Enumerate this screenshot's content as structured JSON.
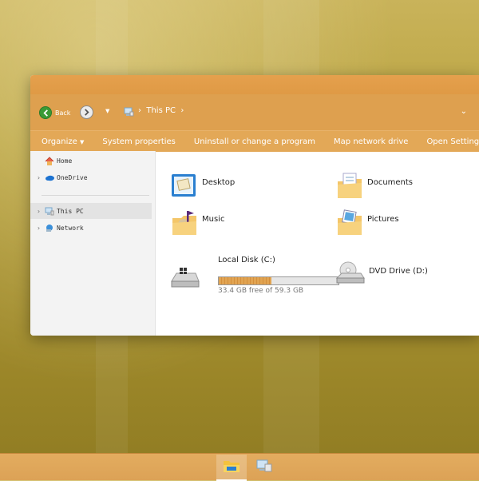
{
  "window": {
    "nav": {
      "back_label": "Back",
      "path_segment": "This PC"
    },
    "commands": [
      {
        "label": "Organize",
        "has_dropdown": true
      },
      {
        "label": "System properties"
      },
      {
        "label": "Uninstall or change a program"
      },
      {
        "label": "Map network drive"
      },
      {
        "label": "Open Settings"
      }
    ],
    "sidebar": {
      "items": [
        {
          "label": "Home",
          "icon": "home-icon"
        },
        {
          "label": "OneDrive",
          "icon": "cloud-icon"
        },
        {
          "label": "This PC",
          "icon": "computer-icon",
          "selected": true
        },
        {
          "label": "Network",
          "icon": "network-icon"
        }
      ]
    },
    "folders": [
      {
        "label": "Desktop",
        "icon": "desktop-folder-icon"
      },
      {
        "label": "Documents",
        "icon": "documents-folder-icon"
      },
      {
        "label": "Music",
        "icon": "music-folder-icon"
      },
      {
        "label": "Pictures",
        "icon": "pictures-folder-icon"
      }
    ],
    "drives": [
      {
        "label": "Local Disk (C:)",
        "free_text": "33.4 GB free of 59.3 GB",
        "used_fraction": 0.437,
        "icon": "hard-drive-icon"
      },
      {
        "label": "DVD Drive (D:)",
        "icon": "dvd-drive-icon"
      }
    ]
  },
  "taskbar": {
    "apps": [
      {
        "icon": "file-explorer-icon",
        "active": true
      },
      {
        "icon": "control-panel-icon",
        "active": false
      }
    ]
  },
  "colors": {
    "accent": "#dea04f",
    "titlebar": "#e5a04d",
    "taskbar": "#e3ac5f"
  }
}
